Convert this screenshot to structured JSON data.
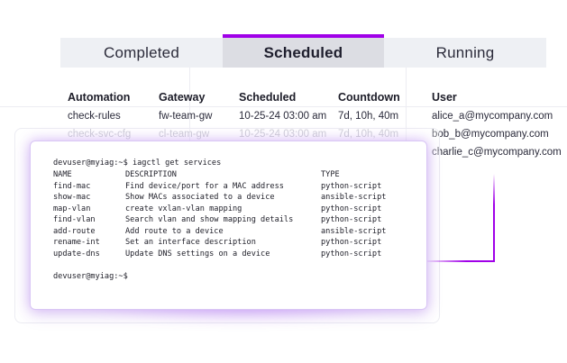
{
  "tabs": [
    {
      "label": "Completed"
    },
    {
      "label": "Scheduled"
    },
    {
      "label": "Running"
    }
  ],
  "active_tab": "Scheduled",
  "accent_color": "#a000e8",
  "table": {
    "headers": [
      "Automation",
      "Gateway",
      "Scheduled",
      "Countdown",
      "User"
    ],
    "rows": [
      {
        "automation": "check-rules",
        "gateway": "fw-team-gw",
        "scheduled": "10-25-24 03:00 am",
        "countdown": "7d, 10h, 40m",
        "user": "alice_a@mycompany.com"
      },
      {
        "automation": "check-svc-cfg",
        "gateway": "cl-team-gw",
        "scheduled": "10-25-24 03:00 am",
        "countdown": "7d, 10h, 40m",
        "user": "bob_b@mycompany.com"
      },
      {
        "user": "charlie_c@mycompany.com"
      }
    ]
  },
  "terminal": {
    "prompt_command": "devuser@myiag:~$ iagctl get services",
    "columns": [
      "NAME",
      "DESCRIPTION",
      "TYPE"
    ],
    "services": [
      {
        "name": "find-mac",
        "description": "Find device/port for a MAC address",
        "type": "python-script"
      },
      {
        "name": "show-mac",
        "description": "Show MACs associated to a device",
        "type": "ansible-script"
      },
      {
        "name": "map-vlan",
        "description": "create vxlan-vlan mapping",
        "type": "python-script"
      },
      {
        "name": "find-vlan",
        "description": "Search vlan and show mapping details",
        "type": "python-script"
      },
      {
        "name": "add-route",
        "description": "Add route to a device",
        "type": "ansible-script"
      },
      {
        "name": "rename-int",
        "description": "Set an interface description",
        "type": "python-script"
      },
      {
        "name": "update-dns",
        "description": "Update DNS settings on a device",
        "type": "python-script"
      }
    ],
    "final_prompt": "devuser@myiag:~$"
  }
}
